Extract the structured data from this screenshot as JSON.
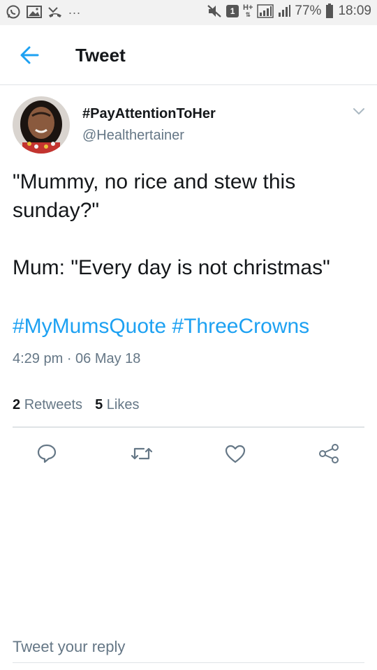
{
  "status_bar": {
    "left_icons": [
      "whatsapp-icon",
      "image-icon",
      "missed-call-icon"
    ],
    "dots": "...",
    "notification_count": "1",
    "network": "H+",
    "battery": "77%",
    "time": "18:09"
  },
  "header": {
    "title": "Tweet",
    "back_icon": "arrow-left-icon"
  },
  "tweet": {
    "display_name": "#PayAttentionToHer",
    "handle": "@Healthertainer",
    "text": "\"Mummy, no rice and stew this sunday?\"\n\nMum: \"Every day is not christmas\"",
    "hashtags": [
      "#MyMumsQuote",
      "#ThreeCrowns"
    ],
    "timestamp": "4:29 pm · 06 May 18",
    "retweets_count": "2",
    "retweets_label": "Retweets",
    "likes_count": "5",
    "likes_label": "Likes"
  },
  "actions": [
    "reply-icon",
    "retweet-icon",
    "like-icon",
    "share-icon"
  ],
  "reply": {
    "placeholder": "Tweet your reply"
  },
  "colors": {
    "accent": "#1da1f2",
    "secondary_text": "#657786",
    "primary_text": "#14171a",
    "divider": "#dfe3e6",
    "status_bar_bg": "#f2f2f2"
  }
}
